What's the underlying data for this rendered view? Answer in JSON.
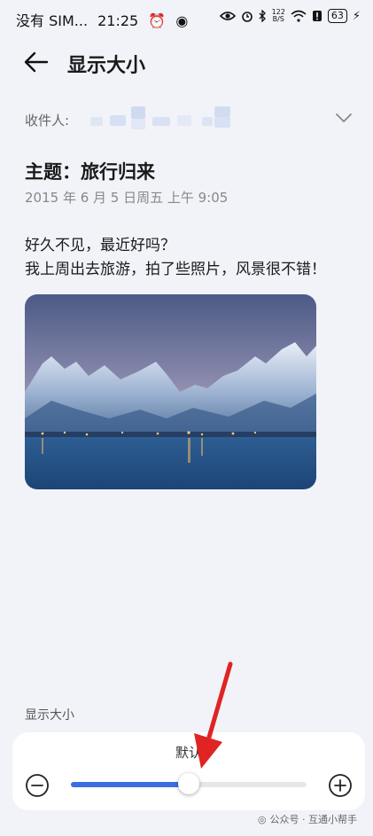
{
  "status_bar": {
    "carrier": "没有 SIM...",
    "time": "21:25",
    "net_speed_value": "122",
    "net_speed_unit": "B/S",
    "battery": "63"
  },
  "header": {
    "title": "显示大小"
  },
  "email": {
    "recipient_label": "收件人:",
    "subject": "主题：旅行归来",
    "date": "2015 年 6 月 5 日周五 上午 9:05",
    "body_lines": [
      "好久不见，最近好吗？",
      "我上周出去旅游，拍了些照片，风景很不错！"
    ]
  },
  "display_size": {
    "section_label": "显示大小",
    "current_label": "默认",
    "slider_level": 0.5,
    "accent_color": "#3b6fe0"
  },
  "watermark": {
    "text": "公众号 · 互通小帮手"
  },
  "annotation_color": "#e02424"
}
